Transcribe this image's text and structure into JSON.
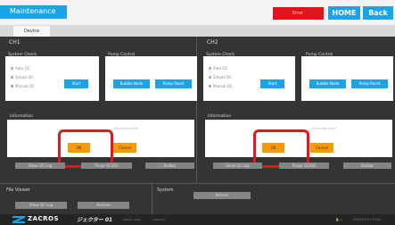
{
  "header": {
    "title": "Maintenance",
    "status_text": "Error",
    "home_label": "HOME",
    "back_label": "Back",
    "tab_label": "Device"
  },
  "channels": [
    {
      "name": "CH1",
      "system_check": {
        "title": "System Check",
        "options": [
          "Auto QC",
          "Simple QC",
          "Manual QC"
        ],
        "selected": "Manual QC",
        "start_label": "Start"
      },
      "pump_control": {
        "title": "Pump Control",
        "bubble_label": "Bubble Node",
        "pump_label": "Pump Reset"
      },
      "information": {
        "title": "Information",
        "message": "Not ready state",
        "ok_label": "OK",
        "cancel_label": "Cancel"
      },
      "bottom_buttons": [
        "Show QC Log",
        "Purge QC/DQ",
        "Rollbar"
      ]
    },
    {
      "name": "CH2",
      "system_check": {
        "title": "System Check",
        "options": [
          "Auto QC",
          "Simple QC",
          "Manual QC"
        ],
        "selected": "Manual QC",
        "start_label": "Start"
      },
      "pump_control": {
        "title": "Pump Control",
        "bubble_label": "Bubble Node",
        "pump_label": "Pump Reset"
      },
      "information": {
        "title": "Information",
        "message": "Not ready state",
        "ok_label": "OK",
        "cancel_label": "Cancel"
      },
      "bottom_buttons": [
        "Show QC Log",
        "Purge QC/DQ",
        "Rollbar"
      ]
    }
  ],
  "file_viewer": {
    "title": "File Viewer",
    "buttons": [
      "Show QC Log",
      "Restore"
    ]
  },
  "system": {
    "title": "System",
    "button": "Refresh"
  },
  "footer": {
    "brand": "ZACROS",
    "brand2": "ジェクター 01",
    "small1": "serial: xxxx",
    "small2": "version",
    "datetime": "2020/01/01 00:00"
  },
  "colors": {
    "accent": "#1aa3e8",
    "warn": "#f39c0b",
    "alert": "#e0141b"
  }
}
